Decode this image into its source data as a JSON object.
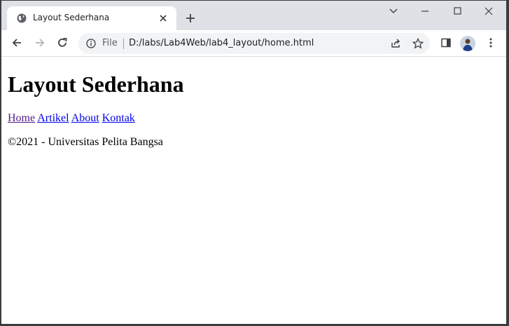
{
  "browser": {
    "tab": {
      "title": "Layout Sederhana"
    },
    "omnibox": {
      "scheme_label": "File",
      "url": "D:/labs/Lab4Web/lab4_layout/home.html"
    }
  },
  "page": {
    "heading": "Layout Sederhana",
    "nav": [
      {
        "label": "Home"
      },
      {
        "label": "Artikel"
      },
      {
        "label": "About"
      },
      {
        "label": "Kontak"
      }
    ],
    "footer": "©2021 - Universitas Pelita Bangsa"
  }
}
